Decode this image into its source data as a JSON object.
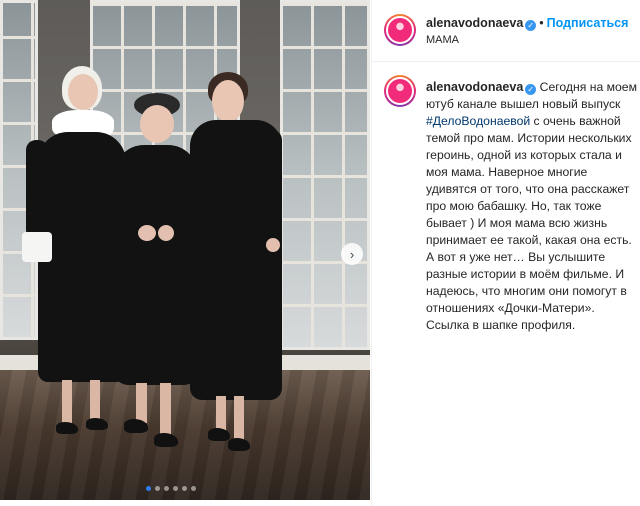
{
  "post": {
    "username": "alenavodonaeva",
    "separator": "•",
    "follow_label": "Подписаться",
    "location": "МАМА",
    "caption": {
      "text_before": "Сегодня на моем ютуб канале вышел новый выпуск ",
      "hashtag": "#ДелоВодонаевой",
      "text_after": " с очень важной темой про мам. Истории нескольких героинь, одной из которых стала и моя мама. Наверное многие удивятся от того, что она расскажет про мою бабашку. Но, так тоже бывает ) И моя мама всю жизнь принимает ее такой, какая она есть. А вот я уже нет… Вы услышите разные истории в моём фильме. И надеюсь, что многим они помогут в отношениях «Дочки-Матери». Ссылка в шапке профиля."
    },
    "carousel": {
      "next_icon": "chevron-right-icon",
      "next_glyph": "›",
      "slide_count": 6,
      "active_index": 0
    }
  },
  "colors": {
    "follow": "#0095f6",
    "hashtag": "#00376b",
    "verified": "#3897f0",
    "active_dot": "#2f7cf6"
  }
}
